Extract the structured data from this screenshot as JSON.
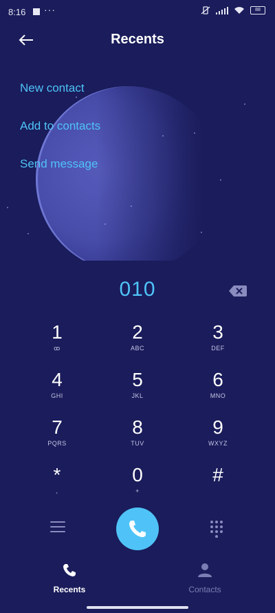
{
  "status_bar": {
    "time": "8:16",
    "dots": "···",
    "battery_label": "88"
  },
  "header": {
    "title": "Recents",
    "back_icon": "arrow-left-icon"
  },
  "actions": [
    {
      "label": "New contact"
    },
    {
      "label": "Add to contacts"
    },
    {
      "label": "Send message"
    }
  ],
  "dialer": {
    "number": "010",
    "backspace_icon": "backspace-icon"
  },
  "keypad": [
    {
      "digit": "1",
      "sub": "ꝏ"
    },
    {
      "digit": "2",
      "sub": "ABC"
    },
    {
      "digit": "3",
      "sub": "DEF"
    },
    {
      "digit": "4",
      "sub": "GHI"
    },
    {
      "digit": "5",
      "sub": "JKL"
    },
    {
      "digit": "6",
      "sub": "MNO"
    },
    {
      "digit": "7",
      "sub": "PQRS"
    },
    {
      "digit": "8",
      "sub": "TUV"
    },
    {
      "digit": "9",
      "sub": "WXYZ"
    },
    {
      "digit": "*",
      "sub": ","
    },
    {
      "digit": "0",
      "sub": "+"
    },
    {
      "digit": "#",
      "sub": ""
    }
  ],
  "controls": {
    "menu_icon": "menu-icon",
    "call_icon": "phone-icon",
    "dialpad_icon": "dialpad-icon"
  },
  "tabs": [
    {
      "label": "Recents",
      "active": true,
      "icon": "phone-icon"
    },
    {
      "label": "Contacts",
      "active": false,
      "icon": "person-icon"
    }
  ],
  "colors": {
    "background": "#1a1c5b",
    "accent": "#4fc3f7",
    "text": "#ffffff",
    "muted": "#7b7eb4"
  }
}
